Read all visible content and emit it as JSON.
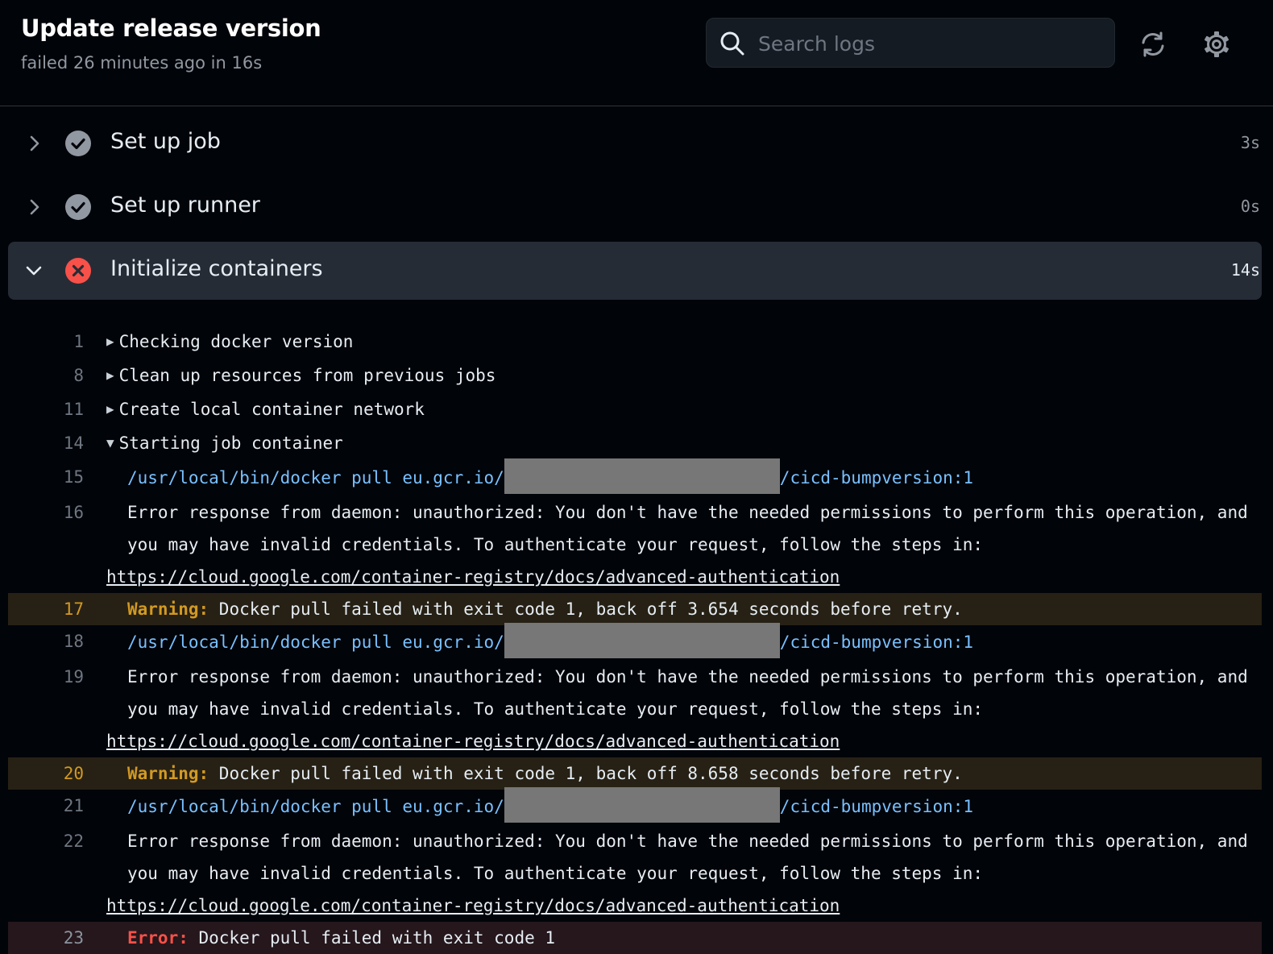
{
  "job": {
    "title": "Update release version",
    "subtitle": "failed 26 minutes ago in 16s"
  },
  "search": {
    "placeholder": "Search logs"
  },
  "header_icons": [
    "refresh-icon",
    "gear-icon"
  ],
  "steps": [
    {
      "name": "Set up job",
      "duration": "3s",
      "status": "success",
      "expanded": false
    },
    {
      "name": "Set up runner",
      "duration": "0s",
      "status": "success",
      "expanded": false
    },
    {
      "name": "Initialize containers",
      "duration": "14s",
      "status": "failure",
      "expanded": true
    }
  ],
  "log": {
    "lines": [
      {
        "n": "1",
        "text": "Checking docker version",
        "group": "collapsed"
      },
      {
        "n": "8",
        "text": "Clean up resources from previous jobs",
        "group": "collapsed"
      },
      {
        "n": "11",
        "text": "Create local container network",
        "group": "collapsed"
      },
      {
        "n": "14",
        "text": "Starting job container",
        "group": "expanded"
      },
      {
        "n": "15",
        "cmd_prefix": "/usr/local/bin/docker pull eu.gcr.io/",
        "cmd_suffix": "/cicd-bumpversion:1",
        "redacted": true
      },
      {
        "n": "16",
        "text": "Error response from daemon: unauthorized: You don't have the needed permissions to perform this operation, and you may have invalid credentials. To authenticate your request, follow the steps in: ",
        "url": "https://cloud.google.com/container-registry/docs/advanced-authentication"
      },
      {
        "n": "17",
        "label": "Warning:",
        "text": " Docker pull failed with exit code 1, back off 3.654 seconds before retry."
      },
      {
        "n": "18",
        "cmd_prefix": "/usr/local/bin/docker pull eu.gcr.io/",
        "cmd_suffix": "/cicd-bumpversion:1",
        "redacted": true
      },
      {
        "n": "19",
        "text": "Error response from daemon: unauthorized: You don't have the needed permissions to perform this operation, and you may have invalid credentials. To authenticate your request, follow the steps in: ",
        "url": "https://cloud.google.com/container-registry/docs/advanced-authentication"
      },
      {
        "n": "20",
        "label": "Warning:",
        "text": " Docker pull failed with exit code 1, back off 8.658 seconds before retry."
      },
      {
        "n": "21",
        "cmd_prefix": "/usr/local/bin/docker pull eu.gcr.io/",
        "cmd_suffix": "/cicd-bumpversion:1",
        "redacted": true
      },
      {
        "n": "22",
        "text": "Error response from daemon: unauthorized: You don't have the needed permissions to perform this operation, and you may have invalid credentials. To authenticate your request, follow the steps in: ",
        "url": "https://cloud.google.com/container-registry/docs/advanced-authentication"
      },
      {
        "n": "23",
        "label": "Error:",
        "text": " Docker pull failed with exit code 1"
      }
    ]
  },
  "colors": {
    "background": "#010409",
    "success": "#9198a1",
    "failure": "#f85149",
    "warning": "#d29922",
    "command": "#79c0ff"
  }
}
